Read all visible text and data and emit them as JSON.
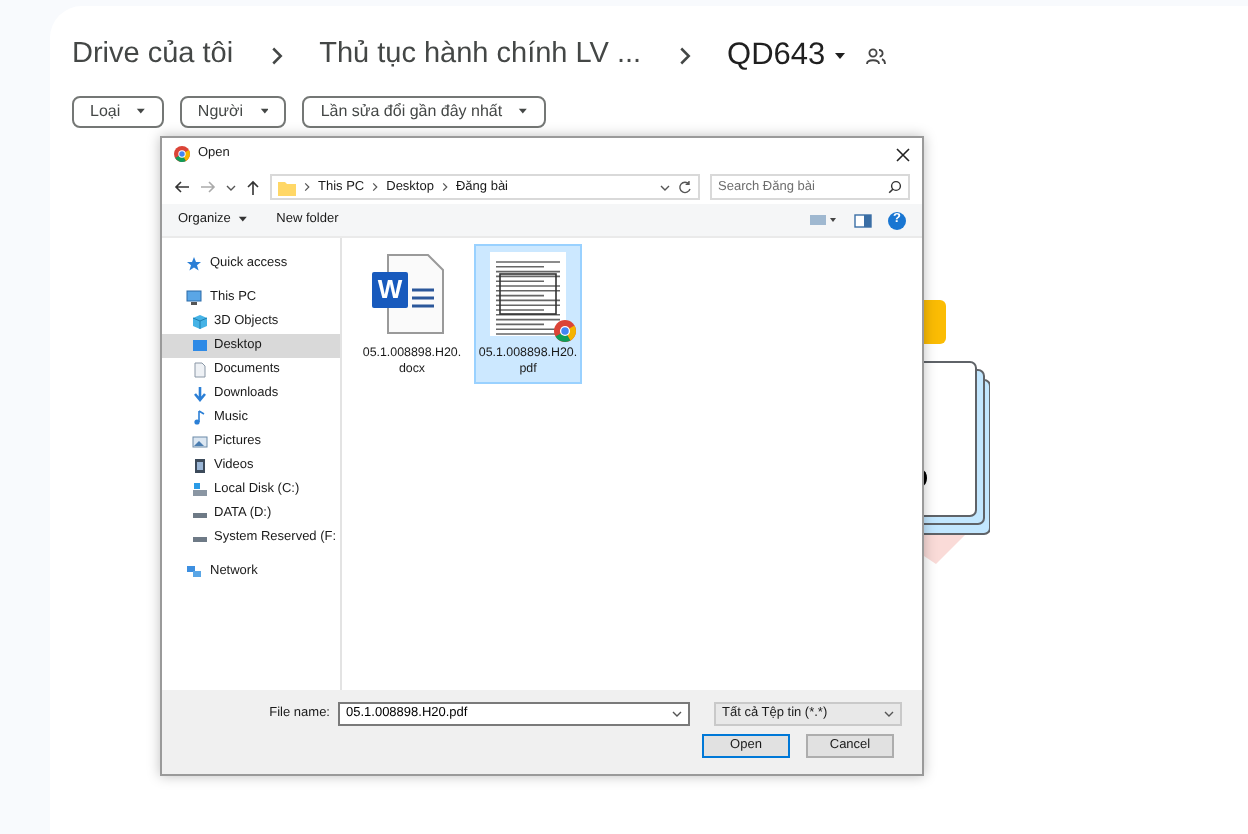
{
  "drive": {
    "breadcrumb": [
      {
        "label": "Drive của tôi",
        "kind": "link"
      },
      {
        "label": "Thủ tục hành chính LV ...",
        "kind": "link"
      },
      {
        "label": "QD643",
        "kind": "current",
        "shared": true
      }
    ],
    "filters": [
      "Loại",
      "Người",
      "Lần sửa đổi gần đây nhất"
    ]
  },
  "dialog": {
    "title": "Open",
    "path": [
      "This PC",
      "Desktop",
      "Đăng bài"
    ],
    "search": {
      "placeholder": "Search Đăng bài"
    },
    "toolbar": {
      "organize": "Organize",
      "new_folder": "New folder",
      "help_glyph": "?"
    },
    "nav": [
      {
        "label": "Quick access",
        "kind": "star",
        "selected": false
      },
      {
        "label": "This PC",
        "kind": "pc",
        "selected": false,
        "children": [
          {
            "label": "3D Objects",
            "kind": "cube",
            "selected": false
          },
          {
            "label": "Desktop",
            "kind": "desktop",
            "selected": true
          },
          {
            "label": "Documents",
            "kind": "docs",
            "selected": false
          },
          {
            "label": "Downloads",
            "kind": "download",
            "selected": false
          },
          {
            "label": "Music",
            "kind": "music",
            "selected": false
          },
          {
            "label": "Pictures",
            "kind": "pictures",
            "selected": false
          },
          {
            "label": "Videos",
            "kind": "videos",
            "selected": false
          },
          {
            "label": "Local Disk (C:)",
            "kind": "system_disk",
            "selected": false
          },
          {
            "label": "DATA (D:)",
            "kind": "disk",
            "selected": false
          },
          {
            "label": "System Reserved (F:",
            "kind": "disk",
            "selected": false
          }
        ]
      },
      {
        "label": "Network",
        "kind": "network",
        "selected": false
      }
    ],
    "files": [
      {
        "name": "05.1.008898.H20.docx",
        "kind": "word",
        "icon_letter": "W",
        "selected": false
      },
      {
        "name": "05.1.008898.H20.pdf",
        "kind": "pdf",
        "selected": true
      }
    ],
    "footer": {
      "filename_label": "File name:",
      "filename": "05.1.008898.H20.pdf",
      "filetype": "Tất cả Tệp tin (*.*)",
      "buttons": [
        {
          "label": "Open",
          "kind": "primary"
        },
        {
          "label": "Cancel",
          "kind": "secondary"
        }
      ]
    }
  }
}
